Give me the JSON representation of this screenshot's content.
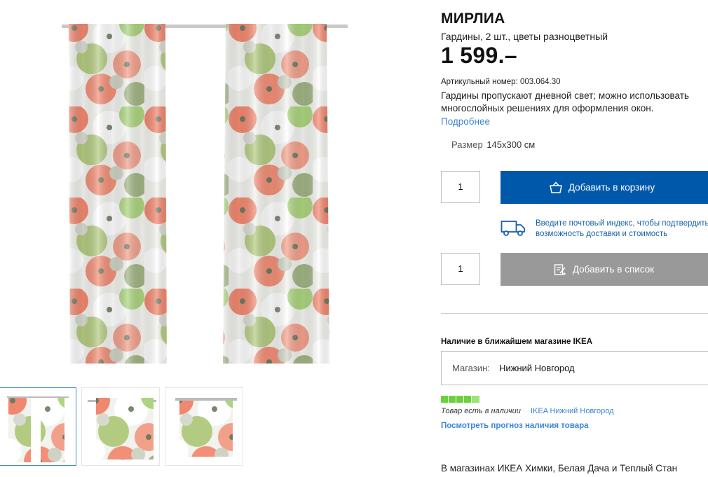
{
  "product": {
    "name": "МИРЛИА",
    "subtitle": "Гардины, 2 шт., цветы разноцветный",
    "price": "1 599.–",
    "article_label": "Артикульный номер:",
    "article_number": "003.064.30",
    "description_line1": "Гардины пропускают дневной свет; можно использовать",
    "description_line2": "многослойных решениях для оформления окон.",
    "more_link": "Подробнее",
    "size_label": "Размер",
    "size_value": "145x300 см"
  },
  "purchase": {
    "quantity": "1",
    "add_to_cart": "Добавить в корзину",
    "delivery_line1": "Введите почтовый индекс, чтобы подтвердить",
    "delivery_line2": "возможность доставки и стоимость",
    "list_quantity": "1",
    "add_to_list": "Добавить в список"
  },
  "availability": {
    "title": "Наличие в ближайшем магазине IKEA",
    "store_label": "Магазин:",
    "store_value": "Нижний Новгород",
    "stock_level": 5,
    "stock_max": 5,
    "stock_text": "Товар есть в наличии",
    "stock_store": "IKEA Нижний Новгород",
    "forecast_link": "Посмотреть прогноз наличия товара"
  },
  "stores_note": "В магазинах ИКЕА Химки, Белая Дача и Теплый Стан",
  "colors": {
    "primary_blue": "#0058ab",
    "link_blue": "#3a85d6",
    "disabled_gray": "#999999",
    "stock_green": "#6bd13c"
  },
  "thumbnails": [
    {
      "name": "curtains-pair",
      "active": true
    },
    {
      "name": "curtain-closeup-1",
      "active": false
    },
    {
      "name": "curtain-closeup-2",
      "active": false
    }
  ]
}
